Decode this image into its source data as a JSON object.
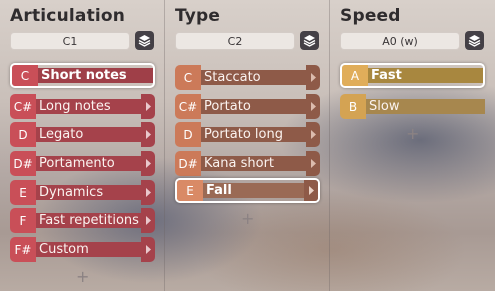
{
  "columns": [
    {
      "title": "Articulation",
      "selector": "C1",
      "items": [
        {
          "key": "C",
          "label": "Short notes",
          "active": true
        },
        {
          "key": "C#",
          "label": "Long notes",
          "active": false
        },
        {
          "key": "D",
          "label": "Legato",
          "active": false
        },
        {
          "key": "D#",
          "label": "Portamento",
          "active": false
        },
        {
          "key": "E",
          "label": "Dynamics",
          "active": false
        },
        {
          "key": "F",
          "label": "Fast repetitions",
          "active": false
        },
        {
          "key": "F#",
          "label": "Custom",
          "active": false
        }
      ],
      "add_label": "+"
    },
    {
      "title": "Type",
      "selector": "C2",
      "items": [
        {
          "key": "C",
          "label": "Staccato",
          "active": false
        },
        {
          "key": "C#",
          "label": "Portato",
          "active": false
        },
        {
          "key": "D",
          "label": "Portato long",
          "active": false
        },
        {
          "key": "D#",
          "label": "Kana short",
          "active": false
        },
        {
          "key": "E",
          "label": "Fall",
          "active": true
        }
      ],
      "add_label": "+"
    },
    {
      "title": "Speed",
      "selector": "A0 (w)",
      "items": [
        {
          "key": "A",
          "label": "Fast",
          "active": true
        },
        {
          "key": "B",
          "label": "Slow",
          "active": false
        }
      ],
      "add_label": "+"
    }
  ],
  "icons": {
    "layers": "layers-icon",
    "chevron": "chevron-right-icon"
  }
}
